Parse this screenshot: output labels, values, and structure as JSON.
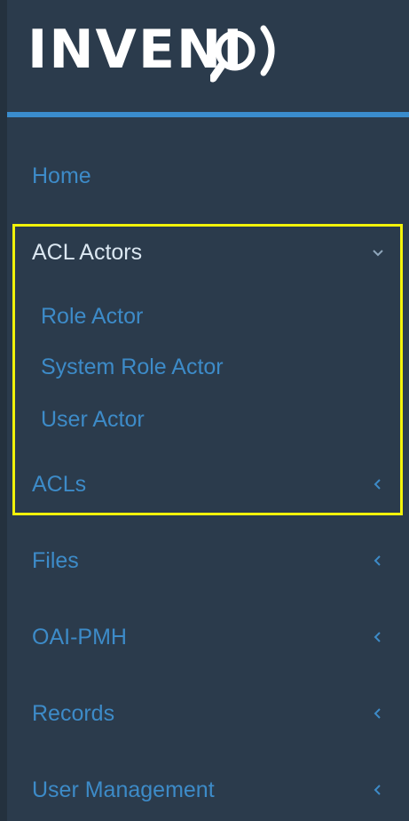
{
  "brand": {
    "logo_text": "INVENI"
  },
  "colors": {
    "sidebar_bg": "#2b3b4c",
    "accent": "#3a8ccd",
    "link": "#3d8bc8",
    "active_text": "#dbe7f1",
    "highlight": "#f2f20a"
  },
  "nav": {
    "home": "Home",
    "acl_actors": {
      "label": "ACL Actors",
      "chevron": "chevron-down-icon",
      "children": {
        "role_actor": "Role Actor",
        "system_role_actor": "System Role Actor",
        "user_actor": "User Actor"
      }
    },
    "acls": "ACLs",
    "files": "Files",
    "oai_pmh": "OAI-PMH",
    "records": "Records",
    "user_management": "User Management"
  }
}
